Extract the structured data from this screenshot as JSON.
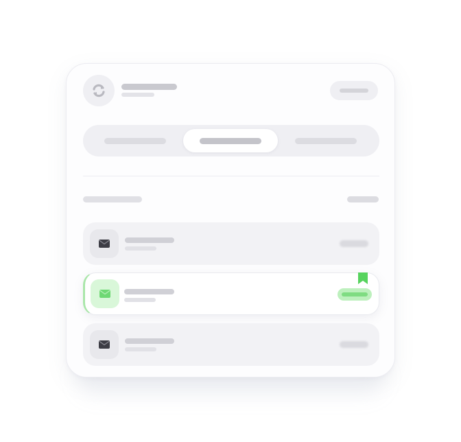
{
  "colors": {
    "card_bg": "#fdfdfe",
    "surface": "#efeff3",
    "placeholder_dark": "#c9c9cf",
    "placeholder_light": "#e3e3e8",
    "accent_green": "#7fdc82",
    "accent_green_light": "#d9f7d9",
    "bookmark_green": "#57d35e",
    "icon_dark": "#3d3d45"
  },
  "header": {
    "logo_icon": "sync-logo-icon",
    "action_pill": "header-action-pill"
  },
  "tabs": {
    "items": [
      "tab-1",
      "tab-2",
      "tab-3"
    ],
    "active_index": 1
  },
  "section": {
    "title_placeholder": "section-title",
    "action_placeholder": "section-action"
  },
  "list": {
    "items": [
      {
        "icon": "envelope-icon",
        "state": "default"
      },
      {
        "icon": "envelope-icon",
        "state": "selected",
        "badge_icon": "bookmark-icon"
      },
      {
        "icon": "envelope-icon",
        "state": "default"
      }
    ]
  }
}
